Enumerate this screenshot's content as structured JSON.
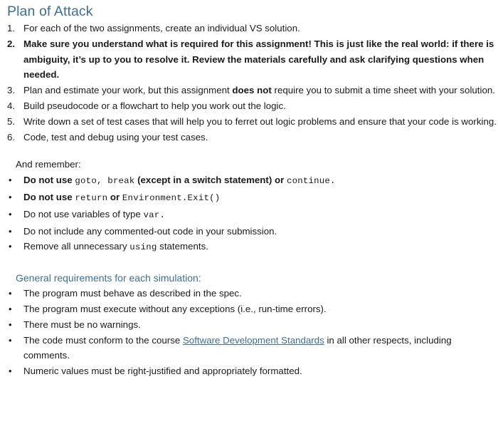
{
  "document": {
    "title": "Plan of Attack",
    "accent_color": "#3d6e93",
    "body_color": "#1a1a1a",
    "background_color": "#ffffff"
  },
  "plan_steps": [
    {
      "number": "1.",
      "bold_item": false,
      "runs": [
        {
          "text": "For each of the two assignments, create an individual VS solution.",
          "style": "normal"
        }
      ]
    },
    {
      "number": "2.",
      "bold_item": true,
      "runs": [
        {
          "text": "Make sure you understand what is required for this assignment!",
          "style": "bold"
        },
        {
          "text": "  This is just like the real world: if there is ambiguity, it’s up to you to resolve it.  Review the materials carefully and ask clarifying questions when needed.",
          "style": "normal"
        }
      ]
    },
    {
      "number": "3.",
      "bold_item": false,
      "runs": [
        {
          "text": "Plan and estimate your work, but this assignment ",
          "style": "normal"
        },
        {
          "text": "does not",
          "style": "bold"
        },
        {
          "text": " require you to submit a time sheet with your solution.",
          "style": "normal"
        }
      ]
    },
    {
      "number": "4.",
      "bold_item": false,
      "runs": [
        {
          "text": "Build pseudocode or a flowchart to help you work out the logic.",
          "style": "normal"
        }
      ]
    },
    {
      "number": "5.",
      "bold_item": false,
      "runs": [
        {
          "text": "Write down a set of test cases that will help you to ferret out logic problems and ensure that your code is working.",
          "style": "normal"
        }
      ]
    },
    {
      "number": "6.",
      "bold_item": false,
      "runs": [
        {
          "text": "Code, test and debug using your test cases.",
          "style": "normal"
        }
      ]
    }
  ],
  "remember": {
    "intro": "And remember:",
    "bullet_char": "•",
    "items": [
      {
        "runs": [
          {
            "text": "Do not use ",
            "style": "bold"
          },
          {
            "text": "goto,  break",
            "style": "code"
          },
          {
            "text": "  (except in a switch statement)",
            "style": "bold"
          },
          {
            "text": " or ",
            "style": "bold"
          },
          {
            "text": "continue.",
            "style": "code"
          }
        ]
      },
      {
        "runs": [
          {
            "text": "Do not use ",
            "style": "bold"
          },
          {
            "text": "return",
            "style": "code"
          },
          {
            "text": " or ",
            "style": "bold"
          },
          {
            "text": "Environment.Exit()",
            "style": "code"
          }
        ]
      },
      {
        "runs": [
          {
            "text": "Do not use variables of type ",
            "style": "normal"
          },
          {
            "text": "var.",
            "style": "code"
          }
        ]
      },
      {
        "runs": [
          {
            "text": "Do not include any commented-out code in your submission.",
            "style": "normal"
          }
        ]
      },
      {
        "runs": [
          {
            "text": "Remove all unnecessary ",
            "style": "normal"
          },
          {
            "text": "using",
            "style": "code"
          },
          {
            "text": " statements.",
            "style": "normal"
          }
        ]
      }
    ]
  },
  "general_requirements": {
    "heading": "General requirements for each simulation:",
    "bullet_char": "•",
    "items": [
      {
        "runs": [
          {
            "text": "The program must behave as described in the spec.",
            "style": "normal"
          }
        ]
      },
      {
        "runs": [
          {
            "text": "The program must execute without any exceptions (i.e., run-time errors).",
            "style": "normal"
          }
        ]
      },
      {
        "runs": [
          {
            "text": "There must be no warnings.",
            "style": "normal"
          }
        ]
      },
      {
        "runs": [
          {
            "text": "The code must conform to the course ",
            "style": "normal"
          },
          {
            "text": "Software Development Standards",
            "style": "link"
          },
          {
            "text": " in all other respects, including comments.",
            "style": "normal"
          }
        ]
      },
      {
        "runs": [
          {
            "text": "Numeric values must be right-justified and appropriately formatted.",
            "style": "normal"
          }
        ]
      }
    ]
  }
}
